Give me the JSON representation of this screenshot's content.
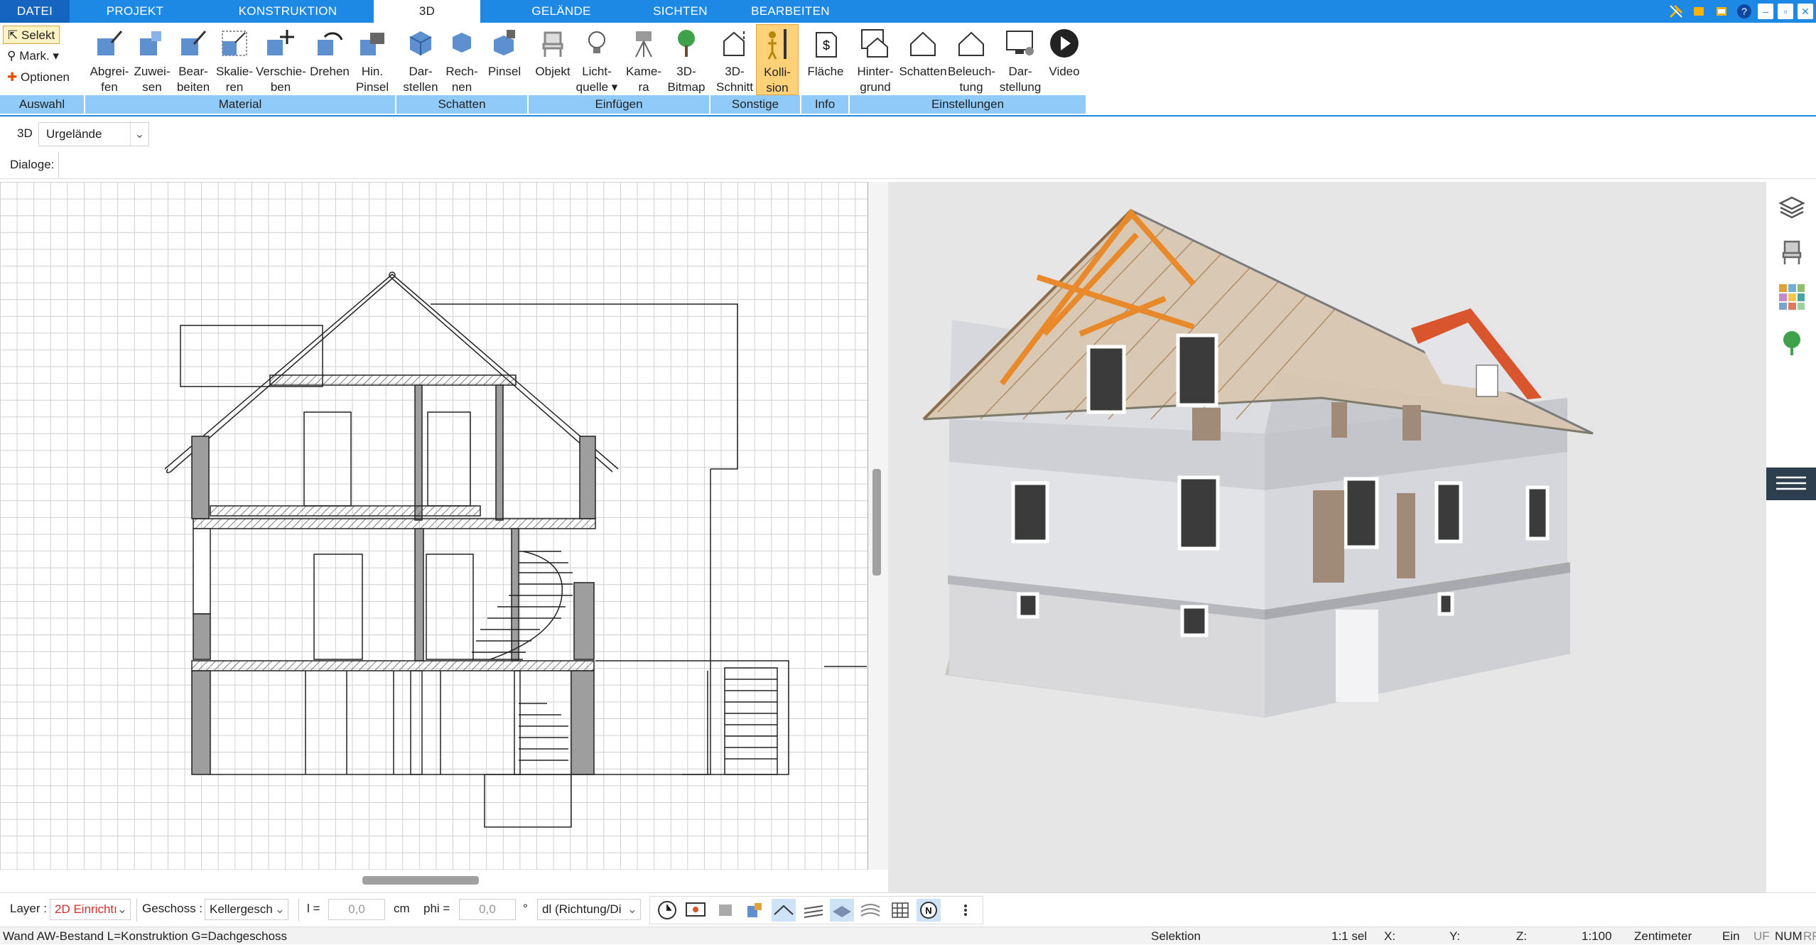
{
  "tabs": [
    "DATEI",
    "PROJEKT",
    "KONSTRUKTION",
    "3D",
    "GELÄNDE",
    "SICHTEN",
    "BEARBEITEN"
  ],
  "active_tab": "3D",
  "window_controls": [
    "tools-icon",
    "window-icon",
    "window-icon",
    "help-icon",
    "minimize-icon",
    "restore-icon",
    "close-icon"
  ],
  "auswahl": {
    "selekt": "Selekt",
    "mark": "Mark.",
    "optionen": "Optionen",
    "label": "Auswahl"
  },
  "groups": {
    "material": "Material",
    "schatten": "Schatten",
    "einfuegen": "Einfügen",
    "sonstige": "Sonstige",
    "info": "Info",
    "einstellungen": "Einstellungen"
  },
  "buttons": {
    "abgreifen": [
      "Abgrei-",
      "fen"
    ],
    "zuweisen": [
      "Zuwei-",
      "sen"
    ],
    "bearbeiten": [
      "Bear-",
      "beiten"
    ],
    "skalieren": [
      "Skalie-",
      "ren"
    ],
    "verschieben": [
      "Verschie-",
      "ben"
    ],
    "drehen": [
      "Drehen",
      ""
    ],
    "hinpinsel": [
      "Hin.",
      "Pinsel"
    ],
    "darstellen": [
      "Dar-",
      "stellen"
    ],
    "rechnen": [
      "Rech-",
      "nen"
    ],
    "pinsel": [
      "Pinsel",
      ""
    ],
    "objekt": [
      "Objekt",
      ""
    ],
    "lichtquelle": [
      "Licht-",
      "quelle"
    ],
    "kamera": [
      "Kame-",
      "ra"
    ],
    "bitmap3d": [
      "3D-",
      "Bitmap"
    ],
    "schnitt3d": [
      "3D-",
      "Schnitt"
    ],
    "kollision": [
      "Kolli-",
      "sion"
    ],
    "flaeche": [
      "Fläche",
      ""
    ],
    "hintergrund": [
      "Hinter-",
      "grund"
    ],
    "schatten": [
      "Schatten",
      ""
    ],
    "beleuchtung": [
      "Beleuch-",
      "tung"
    ],
    "darstellung": [
      "Dar-",
      "stellung"
    ],
    "video": [
      "Video",
      ""
    ]
  },
  "subbar": {
    "mode": "3D",
    "terrain": "Urgelände",
    "dialoge": "Dialoge:"
  },
  "bottom": {
    "layer_label": "Layer :",
    "layer_value": "2D Einrichtı",
    "geschoss_label": "Geschoss :",
    "geschoss_value": "Kellergesch",
    "l_label": "l =",
    "l_value": "0,0",
    "l_unit": "cm",
    "phi_label": "phi =",
    "phi_value": "0,0",
    "phi_unit": "°",
    "dl_value": "dl (Richtung/Di"
  },
  "status": {
    "message": "Wand AW-Bestand L=Konstruktion G=Dachgeschoss",
    "mode": "Selektion",
    "sel": "1:1 sel",
    "x": "X:",
    "y": "Y:",
    "z": "Z:",
    "scale": "1:100",
    "unit": "Zentimeter",
    "ein": "Ein",
    "uf": "UF",
    "num": "NUM",
    "rf": "RF"
  },
  "colors": {
    "accent": "#1e88e5",
    "group_band": "#90caf9",
    "active_button": "#ffd27a",
    "roof_beams": "#e8892b",
    "dormer_roof": "#d9552d",
    "floor_slab": "#8a8f5a"
  }
}
